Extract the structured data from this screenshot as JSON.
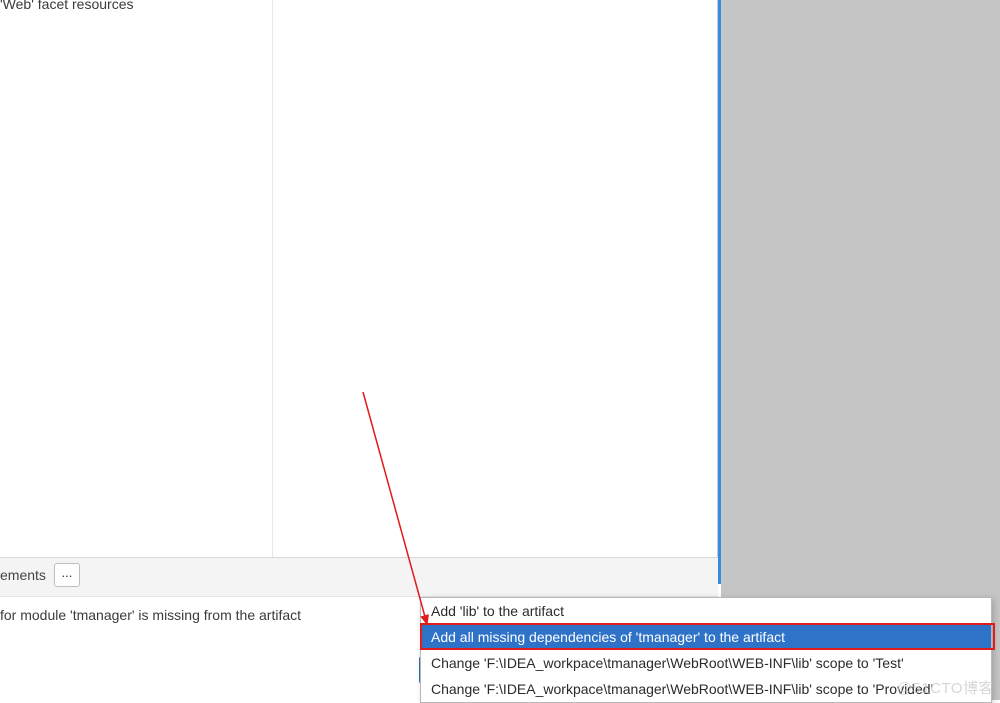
{
  "header": {
    "fragment_text": "'Web' facet resources"
  },
  "panel": {
    "elements_label": "ements",
    "ellipsis_label": "...",
    "warning_text": " for module 'tmanager' is missing from the artifact"
  },
  "context_menu": {
    "items": [
      {
        "label": "Add 'lib' to the artifact",
        "selected": false
      },
      {
        "label": "Add all missing dependencies of 'tmanager' to the artifact",
        "selected": true
      },
      {
        "label": "Change 'F:\\IDEA_workpace\\tmanager\\WebRoot\\WEB-INF\\lib' scope to 'Test'",
        "selected": false
      },
      {
        "label": "Change 'F:\\IDEA_workpace\\tmanager\\WebRoot\\WEB-INF\\lib' scope to 'Provided'",
        "selected": false
      }
    ]
  },
  "annotation": {
    "highlight_color": "#e21b1b",
    "arrow_color": "#e21b1b"
  },
  "watermark": {
    "text": "@51CTO博客"
  }
}
